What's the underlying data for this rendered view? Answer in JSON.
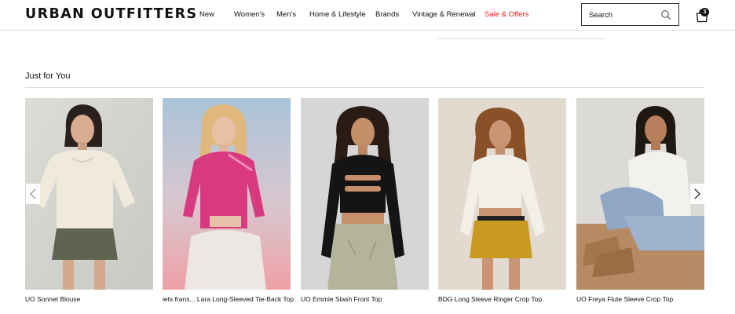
{
  "brand": {
    "logo_text": "URBAN OUTFITTERS"
  },
  "nav": {
    "items": [
      {
        "label": "New"
      },
      {
        "label": "Women's"
      },
      {
        "label": "Men's"
      },
      {
        "label": "Home & Lifestyle"
      },
      {
        "label": "Brands"
      },
      {
        "label": "Vintage & Renewal"
      },
      {
        "label": "Sale & Offers"
      }
    ]
  },
  "search": {
    "placeholder": "Search",
    "icon": "search-icon"
  },
  "bag": {
    "count": "3",
    "icon": "shopping-bag-icon"
  },
  "carousel": {
    "title": "Just for You",
    "prev_icon": "chevron-left-icon",
    "next_icon": "chevron-right-icon",
    "products": [
      {
        "name": "UO Sonnet Blouse"
      },
      {
        "name": "iets frans... Lara Long-Sleeved Tie-Back Top"
      },
      {
        "name": "UO Emmie Slash Front Top"
      },
      {
        "name": "BDG Long Sleeve Ringer Crop Top"
      },
      {
        "name": "UO Freya Flute Sleeve Crop Top"
      }
    ]
  },
  "colors": {
    "sale": "#e1231d",
    "text": "#111111",
    "divider": "#dcdcdc"
  }
}
